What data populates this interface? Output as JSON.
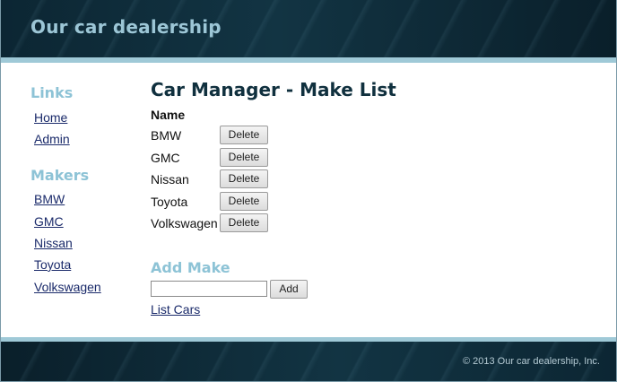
{
  "header": {
    "title": "Our car dealership"
  },
  "sidebar": {
    "links_heading": "Links",
    "links": [
      {
        "label": "Home"
      },
      {
        "label": "Admin"
      }
    ],
    "makers_heading": "Makers",
    "makers": [
      {
        "label": "BMW"
      },
      {
        "label": "GMC"
      },
      {
        "label": "Nissan"
      },
      {
        "label": "Toyota"
      },
      {
        "label": "Volkswagen"
      }
    ]
  },
  "main": {
    "title": "Car Manager - Make List",
    "column_header": "Name",
    "makes": [
      {
        "name": "BMW",
        "action": "Delete"
      },
      {
        "name": "GMC",
        "action": "Delete"
      },
      {
        "name": "Nissan",
        "action": "Delete"
      },
      {
        "name": "Toyota",
        "action": "Delete"
      },
      {
        "name": "Volkswagen",
        "action": "Delete"
      }
    ],
    "add_heading": "Add Make",
    "add_input_value": "",
    "add_button": "Add",
    "list_cars_link": "List Cars"
  },
  "footer": {
    "copyright": "© 2013 Our car dealership, Inc."
  },
  "colors": {
    "header_bg": "#123443",
    "accent": "#9fc9d7",
    "heading_accent": "#8dc3d6",
    "title_text": "#10303e",
    "link": "#1a2a6a"
  }
}
